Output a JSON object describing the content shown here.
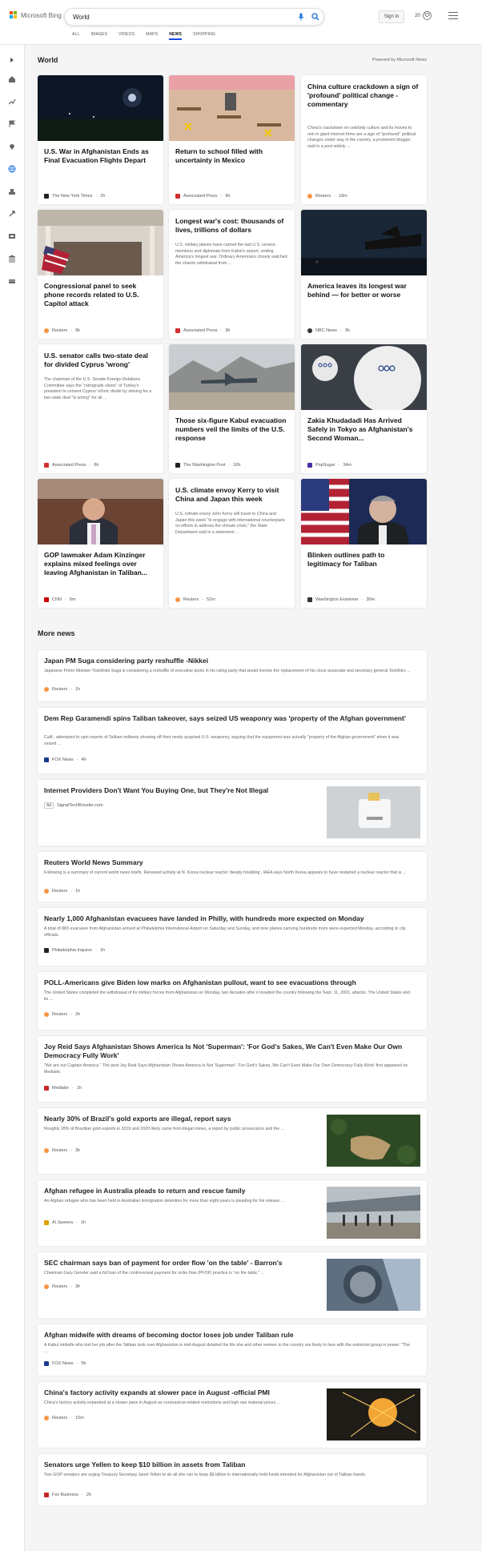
{
  "header": {
    "brand": "Microsoft Bing",
    "search_value": "World",
    "signin": "Sign in",
    "rewards": "20",
    "tabs": [
      "ALL",
      "IMAGES",
      "VIDEOS",
      "MAPS",
      "NEWS",
      "SHOPPING"
    ],
    "active_tab": "NEWS",
    "colors": {
      "accent": "#174ae4"
    }
  },
  "world": {
    "title": "World",
    "powered": "Powered by Microsoft News",
    "cards": [
      {
        "title": "U.S. War in Afghanistan Ends as Final Evacuation Flights Depart",
        "desc": "",
        "source": "The New York Times",
        "time": "2h",
        "logo_color": "#222"
      },
      {
        "title": "Return to school filled with uncertainty in Mexico",
        "desc": "",
        "source": "Associated Press",
        "time": "9h",
        "logo_color": "#d32f2f"
      },
      {
        "title": "China culture crackdown a sign of 'profound' political change - commentary",
        "desc": "China's crackdown on celebrity culture and its moves to rein in giant internet firms are a sign of \"profound\" political changes under way in the country, a prominent blogger said in a post widely ...",
        "source": "Reuters",
        "time": "18m",
        "logo_color": "#f79545"
      },
      {
        "title": "Congressional panel to seek phone records related to U.S. Capitol attack",
        "desc": "",
        "source": "Reuters",
        "time": "9h",
        "logo_color": "#f79545"
      },
      {
        "title": "Longest war's cost: thousands of lives, trillions of dollars",
        "desc": "U.S. military planes have carried the last U.S. service members and diplomats from Kabul's airport, ending America's longest war. Ordinary Americans closely watched the chaotic withdrawal from ...",
        "source": "Associated Press",
        "time": "3h",
        "logo_color": "#d32f2f"
      },
      {
        "title": "America leaves its longest war behind — for better or worse",
        "desc": "",
        "source": "NBC News",
        "time": "3h",
        "logo_color": "#333"
      },
      {
        "title": "U.S. senator calls two-state deal for divided Cyprus 'wrong'",
        "desc": "The chairman of the U.S. Senate Foreign Relations Committee says the \"retrograde vision\" of Turkey's president to cement Cyprus' ethnic divide by striving for a two-state deal \"is wrong\" for all ...",
        "source": "Associated Press",
        "time": "6h",
        "logo_color": "#d32f2f"
      },
      {
        "title": "Those six-figure Kabul evacuation numbers veil the limits of the U.S. response",
        "desc": "",
        "source": "The Washington Post",
        "time": "10h",
        "logo_color": "#222"
      },
      {
        "title": "Zakia Khudadadi Has Arrived Safely in Tokyo as Afghanistan's Second Woman...",
        "desc": "",
        "source": "PopSugar",
        "time": "34m",
        "logo_color": "#4a2ea8"
      },
      {
        "title": "GOP lawmaker Adam Kinzinger explains mixed feelings over leaving Afghanistan in Taliban...",
        "desc": "",
        "source": "CNN",
        "time": "9m",
        "logo_color": "#cc0000"
      },
      {
        "title": "U.S. climate envoy Kerry to visit China and Japan this week",
        "desc": "U.S. climate envoy John Kerry will travel to China and Japan this week \"to engage with international counterparts on efforts to address the climate crisis,\" the State Department said in a statement ...",
        "source": "Reuters",
        "time": "52m",
        "logo_color": "#f79545"
      },
      {
        "title": "Blinken outlines path to legitimacy for Taliban",
        "desc": "",
        "source": "Washington Examiner",
        "time": "30m",
        "logo_color": "#333"
      }
    ]
  },
  "more_news": {
    "title": "More news",
    "items": [
      {
        "title": "Japan PM Suga considering party reshuffle -Nikkei",
        "desc": "Japanese Prime Minister Yoshihide Suga is considering a reshuffle of executive posts in his ruling party that would involve the replacement of his close associate and secretary general Toshihiro ...",
        "source": "Reuters",
        "time": "1h",
        "logo_color": "#f79545"
      },
      {
        "title": "Dem Rep Garamendi spins Taliban takeover, says seized US weaponry was 'property of the Afghan government'",
        "desc": "Calif., attempted to spin reports of Taliban militants showing off their newly acquired U.S. weaponry, arguing that the equipment was actually \"property of the Afghan government\" when it was seized ...",
        "source": "FOX News",
        "time": "4h",
        "logo_color": "#1a3a8f"
      },
      {
        "title": "Internet Providers Don't Want You Buying One, but They're Not Illegal",
        "desc": "",
        "source": "SignalTechBooster.com",
        "time": "",
        "logo_color": "#999",
        "ad": "Ad"
      },
      {
        "title": "Reuters World News Summary",
        "desc": "Following is a summary of current world news briefs. Renewed activity at N. Korea nuclear reactor 'deeply troubling', IAEA says North Korea appears to have restarted a nuclear reactor that is ...",
        "source": "Reuters",
        "time": "1h",
        "logo_color": "#f79545"
      },
      {
        "title": "Nearly 1,000 Afghanistan evacuees have landed in Philly, with hundreds more expected on Monday",
        "desc": "A total of 883 evacuees from Afghanistan arrived at Philadelphia International Airport on Saturday and Sunday, and nine planes carrying hundreds more were expected Monday, according to city officials.",
        "source": "Philadelphia Inquirer",
        "time": "1h",
        "logo_color": "#222"
      },
      {
        "title": "POLL-Americans give Biden low marks on Afghanistan pullout, want to see evacuations through",
        "desc": "The United States completed the withdrawal of its military forces from Afghanistan on Monday, two decades after it invaded the country following the Sept. 11, 2001, attacks. The United States and its ...",
        "source": "Reuters",
        "time": "2h",
        "logo_color": "#f79545"
      },
      {
        "title": "Joy Reid Says Afghanistan Shows America Is Not 'Superman': 'For God's Sakes, We Can't Even Make Our Own Democracy Fully Work'",
        "desc": "\"We are not Captain America.\" The post Joy Reid Says Afghanistan Shows America Is Not 'Superman': 'For God's Sakes, We Can't Even Make Our Own Democracy Fully Work' first appeared on Mediaite.",
        "source": "Mediaite",
        "time": "1h",
        "logo_color": "#c62828"
      },
      {
        "title": "Nearly 30% of Brazil's gold exports are illegal, report says",
        "desc": "Roughly 28% of Brazilian gold exports in 2019 and 2020 likely came from illegal mines, a report by public prosecutors and the ...",
        "source": "Reuters",
        "time": "3h",
        "logo_color": "#f79545"
      },
      {
        "title": "Afghan refugee in Australia pleads to return and rescue family",
        "desc": "An Afghan refugee who has been held in Australian immigration detention for more than eight years is pleading for his release ...",
        "source": "Al Jazeera",
        "time": "1h",
        "logo_color": "#e0a100"
      },
      {
        "title": "SEC chairman says ban of payment for order flow 'on the table' - Barron's",
        "desc": "Chairman Gary Gensler said a full ban of the controversial payment for order flow (PFOF) practice is \"on the table,\" ...",
        "source": "Reuters",
        "time": "3h",
        "logo_color": "#f79545"
      },
      {
        "title": "Afghan midwife with dreams of becoming doctor loses job under Taliban rule",
        "desc": "A Kabul midwife who lost her job after the Taliban took over Afghanistan in mid-August detailed the life she and other women in the country are likely to face with the extremist group in power. \"The ...",
        "source": "FOX News",
        "time": "5h",
        "logo_color": "#1a3a8f"
      },
      {
        "title": "China's factory activity expands at slower pace in August -official PMI",
        "desc": "China's factory activity expanded at a slower pace in August as coronavirus-related restrictions and high raw material prices ...",
        "source": "Reuters",
        "time": "15m",
        "logo_color": "#f79545"
      },
      {
        "title": "Senators urge Yellen to keep $10 billion in assets from Taliban",
        "desc": "Two GOP senators are urging Treasury Secretary Janet Yellen to do all she can to keep $9 billion in internationally-held funds intended for Afghanistan out of Taliban hands.",
        "source": "Fox Business",
        "time": "2h",
        "logo_color": "#c62828"
      }
    ]
  }
}
